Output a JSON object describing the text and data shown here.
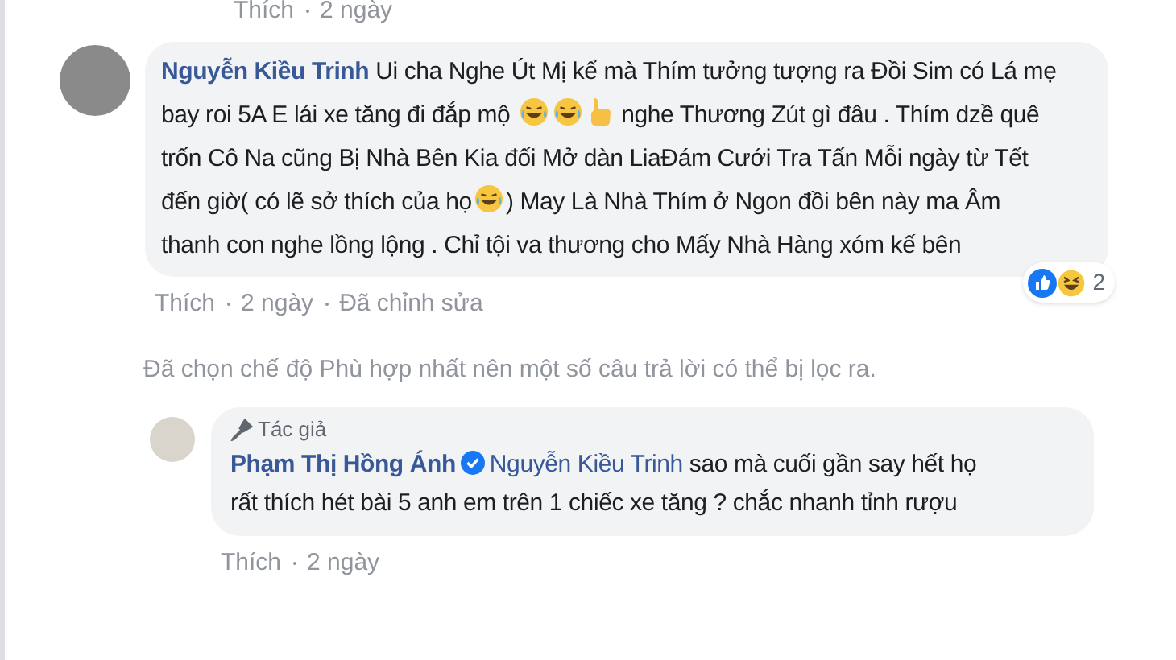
{
  "previous_actions": [
    {
      "text": "Thích"
    },
    {
      "text": "2 ngày"
    }
  ],
  "comment": {
    "author": "Nguyễn Kiều Trinh",
    "segments": [
      {
        "kind": "text",
        "text": "Ui cha Nghe Út Mị kể mà Thím tưởng tượng ra Đồi Sim có Lá mẹ bay roi 5A E lái xe tăng đi đắp mộ "
      },
      {
        "kind": "laugh"
      },
      {
        "kind": "laugh"
      },
      {
        "kind": "thumbs_up"
      },
      {
        "kind": "text",
        "text": "  nghe Thương Zút gì đâu . Thím dzề quê trốn Cô Na cũng Bị Nhà Bên Kia đối Mở dàn LiaĐám Cưới Tra Tấn Mỗi ngày từ Tết đến giờ( có lẽ sở thích của họ"
      },
      {
        "kind": "laugh"
      },
      {
        "kind": "text",
        "text": ") May Là Nhà Thím ở Ngon đồi bên này ma Âm thanh con nghe lồng lộng . Chỉ tội va thương cho Mấy Nhà Hàng xóm kế bên"
      }
    ],
    "reactions": {
      "count": "2"
    },
    "actions": [
      {
        "text": "Thích"
      },
      {
        "text": "2 ngày"
      },
      {
        "text": "Đã chỉnh sửa"
      }
    ]
  },
  "filter_notice": "Đã chọn chế độ Phù hợp nhất nên một số câu trả lời có thể bị lọc ra.",
  "reply": {
    "badge": "Tác giả",
    "author": "Phạm Thị Hồng Ánh",
    "verified": true,
    "mention": "Nguyễn Kiều Trinh",
    "text": " sao mà cuối gần say hết họ rất thích hét bài 5 anh em trên 1 chiếc xe tăng ? chắc nhanh tỉnh rượu",
    "actions": [
      {
        "text": "Thích"
      },
      {
        "text": "2 ngày"
      }
    ]
  }
}
